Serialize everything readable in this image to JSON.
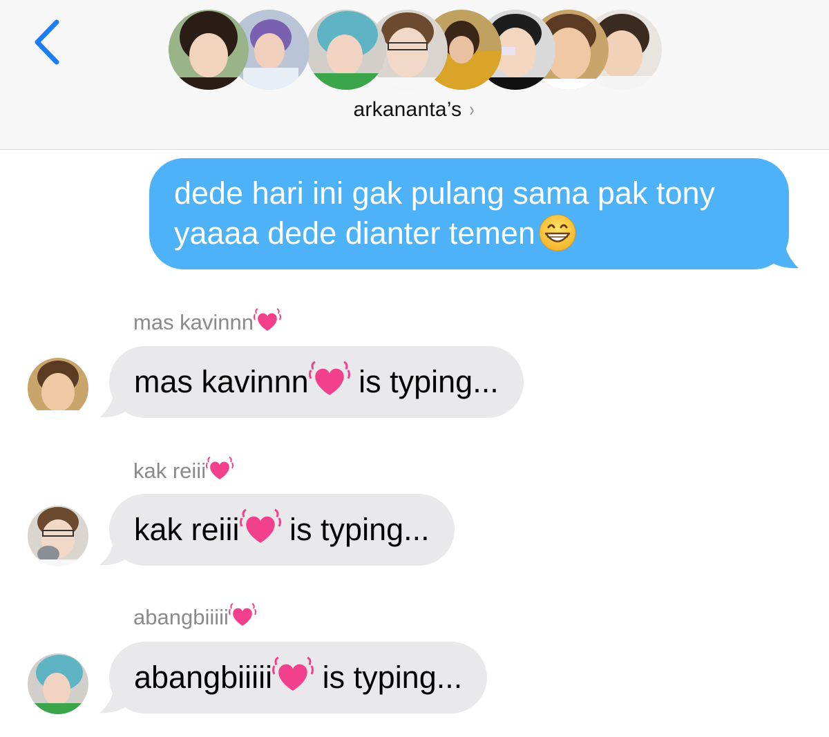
{
  "header": {
    "group_name": "arkananta’s",
    "chevron": "›",
    "back_icon": "chevron-left-icon",
    "member_count_shown": 8
  },
  "outgoing": {
    "text_line1": "dede hari ini gak pulang sama pak tony",
    "text_line2": "yaaaa dede dianter temen",
    "emoji": "grinning-face-icon"
  },
  "incoming": [
    {
      "sender": "mas kavinnn",
      "message_name": "mas kavinnn",
      "message_suffix": " is typing..."
    },
    {
      "sender": "kak reiii",
      "message_name": "kak reiii",
      "message_suffix": " is typing..."
    },
    {
      "sender": "abangbiiiii",
      "message_name": "abangbiiiii",
      "message_suffix": " is typing..."
    }
  ],
  "colors": {
    "accent_blue": "#1a7cf6",
    "outgoing_bubble": "#4db2f7",
    "incoming_bubble": "#e9e9eb",
    "header_bg": "#f7f7f7",
    "sender_gray": "#8a8a8e",
    "heart_pink": "#f2408d"
  }
}
